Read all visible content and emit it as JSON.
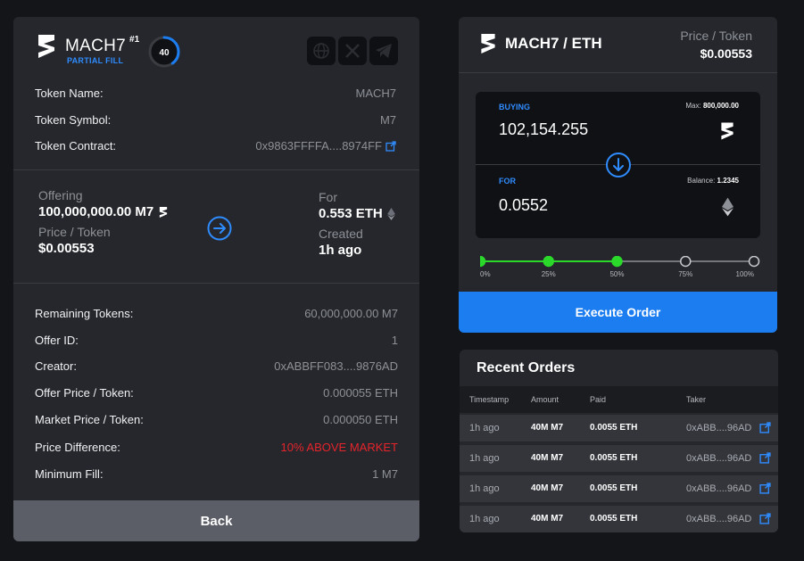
{
  "token": {
    "brand": "MACH7",
    "rank": "#1",
    "status": "PARTIAL FILL",
    "progress_label": "40",
    "progress": 0.4
  },
  "socials": [
    {
      "icon": "globe-icon"
    },
    {
      "icon": "x-icon"
    },
    {
      "icon": "telegram-icon"
    }
  ],
  "details": [
    {
      "key": "Token Name:",
      "value": "MACH7"
    },
    {
      "key": "Token Symbol:",
      "value": "M7"
    },
    {
      "key": "Token Contract:",
      "value": "0x9863FFFFA....8974FF"
    }
  ],
  "offer": {
    "offering_label": "Offering",
    "offering_value": "100,000,000.00 M7",
    "price_label": "Price / Token",
    "price_value": "$0.00553",
    "for_label": "For",
    "for_value": "0.553 ETH",
    "created_label": "Created",
    "created_value": "1h ago"
  },
  "info": [
    {
      "key": "Remaining Tokens:",
      "value": "60,000,000.00 M7",
      "highlight": false
    },
    {
      "key": "Offer ID:",
      "value": "1",
      "highlight": false
    },
    {
      "key": "Creator:",
      "value": "0xABBFF083....9876AD",
      "highlight": false
    },
    {
      "key": "Offer Price / Token:",
      "value": "0.000055 ETH",
      "highlight": false
    },
    {
      "key": "Market Price / Token:",
      "value": "0.000050 ETH",
      "highlight": false
    },
    {
      "key": "Price Difference:",
      "value": "10% ABOVE MARKET",
      "highlight": true
    },
    {
      "key": "Minimum Fill:",
      "value": "1 M7",
      "highlight": false
    }
  ],
  "back_label": "Back",
  "trade": {
    "pair": "MACH7 / ETH",
    "price_label": "Price / Token",
    "price_value": "$0.00553",
    "buying_label": "BUYING",
    "max_label": "Max:",
    "max_value": "800,000.00",
    "buying_amount": "102,154.255",
    "for_label": "FOR",
    "balance_label": "Balance:",
    "balance_value": "1.2345",
    "for_amount": "0.0552",
    "slider_marks": [
      "0%",
      "25%",
      "50%",
      "75%",
      "100%"
    ],
    "slider_value": 0.5,
    "execute_label": "Execute Order"
  },
  "orders": {
    "title": "Recent Orders",
    "headers": {
      "timestamp": "Timestamp",
      "amount": "Amount",
      "paid": "Paid",
      "taker": "Taker"
    },
    "rows": [
      {
        "timestamp": "1h ago",
        "amount": "40M M7",
        "paid": "0.0055 ETH",
        "taker": "0xABB....96AD"
      },
      {
        "timestamp": "1h ago",
        "amount": "40M M7",
        "paid": "0.0055 ETH",
        "taker": "0xABB....96AD"
      },
      {
        "timestamp": "1h ago",
        "amount": "40M M7",
        "paid": "0.0055 ETH",
        "taker": "0xABB....96AD"
      },
      {
        "timestamp": "1h ago",
        "amount": "40M M7",
        "paid": "0.0055 ETH",
        "taker": "0xABB....96AD"
      }
    ]
  },
  "colors": {
    "accent": "#1c7df0",
    "progress_green": "#2bd92b",
    "danger": "#e5242b",
    "card": "#25272c",
    "background": "#141519"
  }
}
